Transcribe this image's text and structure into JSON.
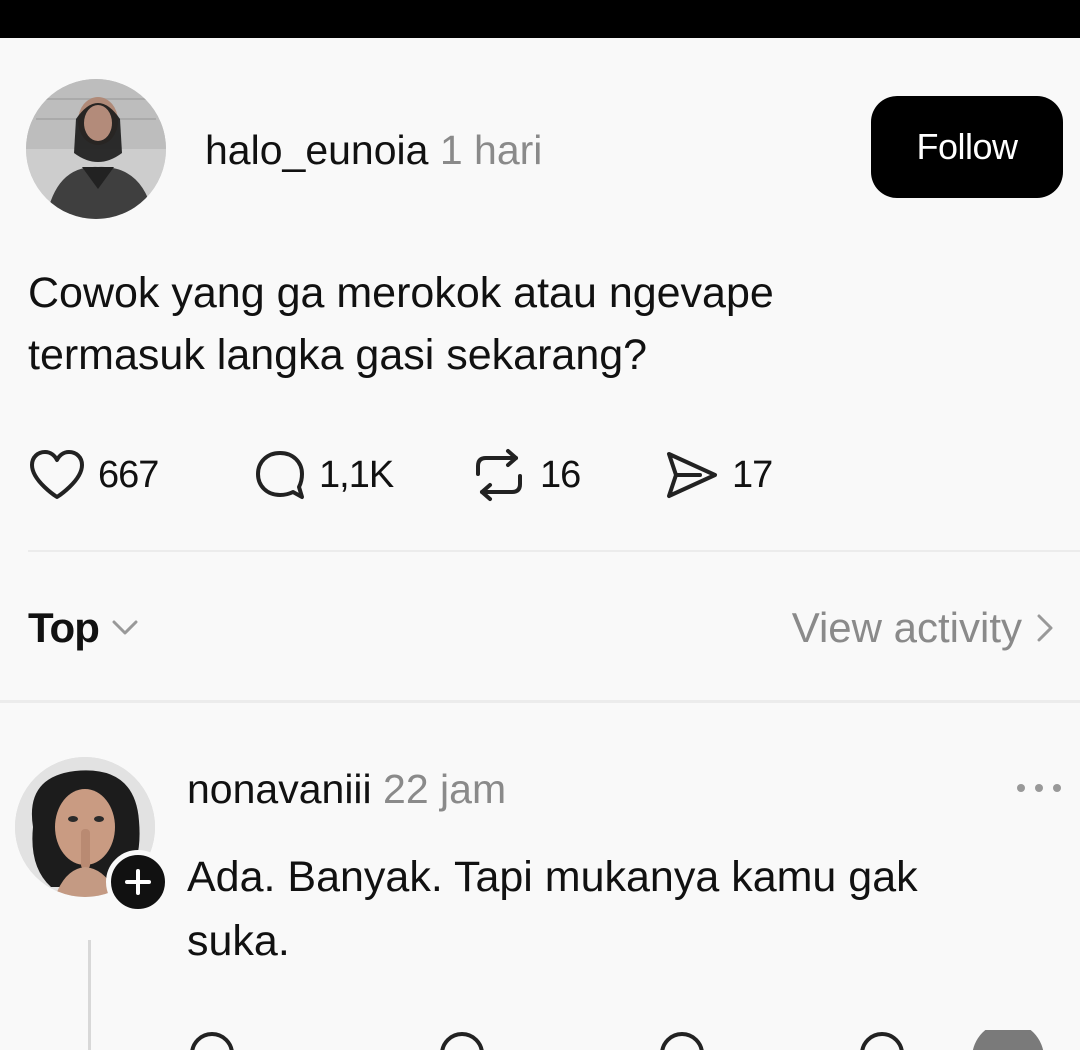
{
  "post": {
    "username": "halo_eunoia",
    "time": "1 hari",
    "follow_label": "Follow",
    "text_line1": "Cowok yang ga merokok atau ngevape",
    "text_line2": "termasuk langka gasi sekarang?",
    "likes": "667",
    "comments": "1,1K",
    "reposts": "16",
    "shares": "17"
  },
  "sort": {
    "label": "Top",
    "view_activity": "View activity"
  },
  "comment": {
    "username": "nonavaniii",
    "time": "22 jam",
    "text_line1": "Ada. Banyak. Tapi mukanya kamu gak",
    "text_line2": "suka."
  },
  "icons": {
    "like": "heart-icon",
    "comment": "speech-bubble-icon",
    "repost": "repost-icon",
    "share": "send-icon",
    "sort": "chevron-down-icon",
    "view_activity": "chevron-right-icon",
    "more": "more-dots-icon",
    "follow_badge": "plus-icon"
  },
  "colors": {
    "background": "#f9f9f9",
    "text": "#111111",
    "muted": "#8a8a8a",
    "button": "#000000"
  }
}
